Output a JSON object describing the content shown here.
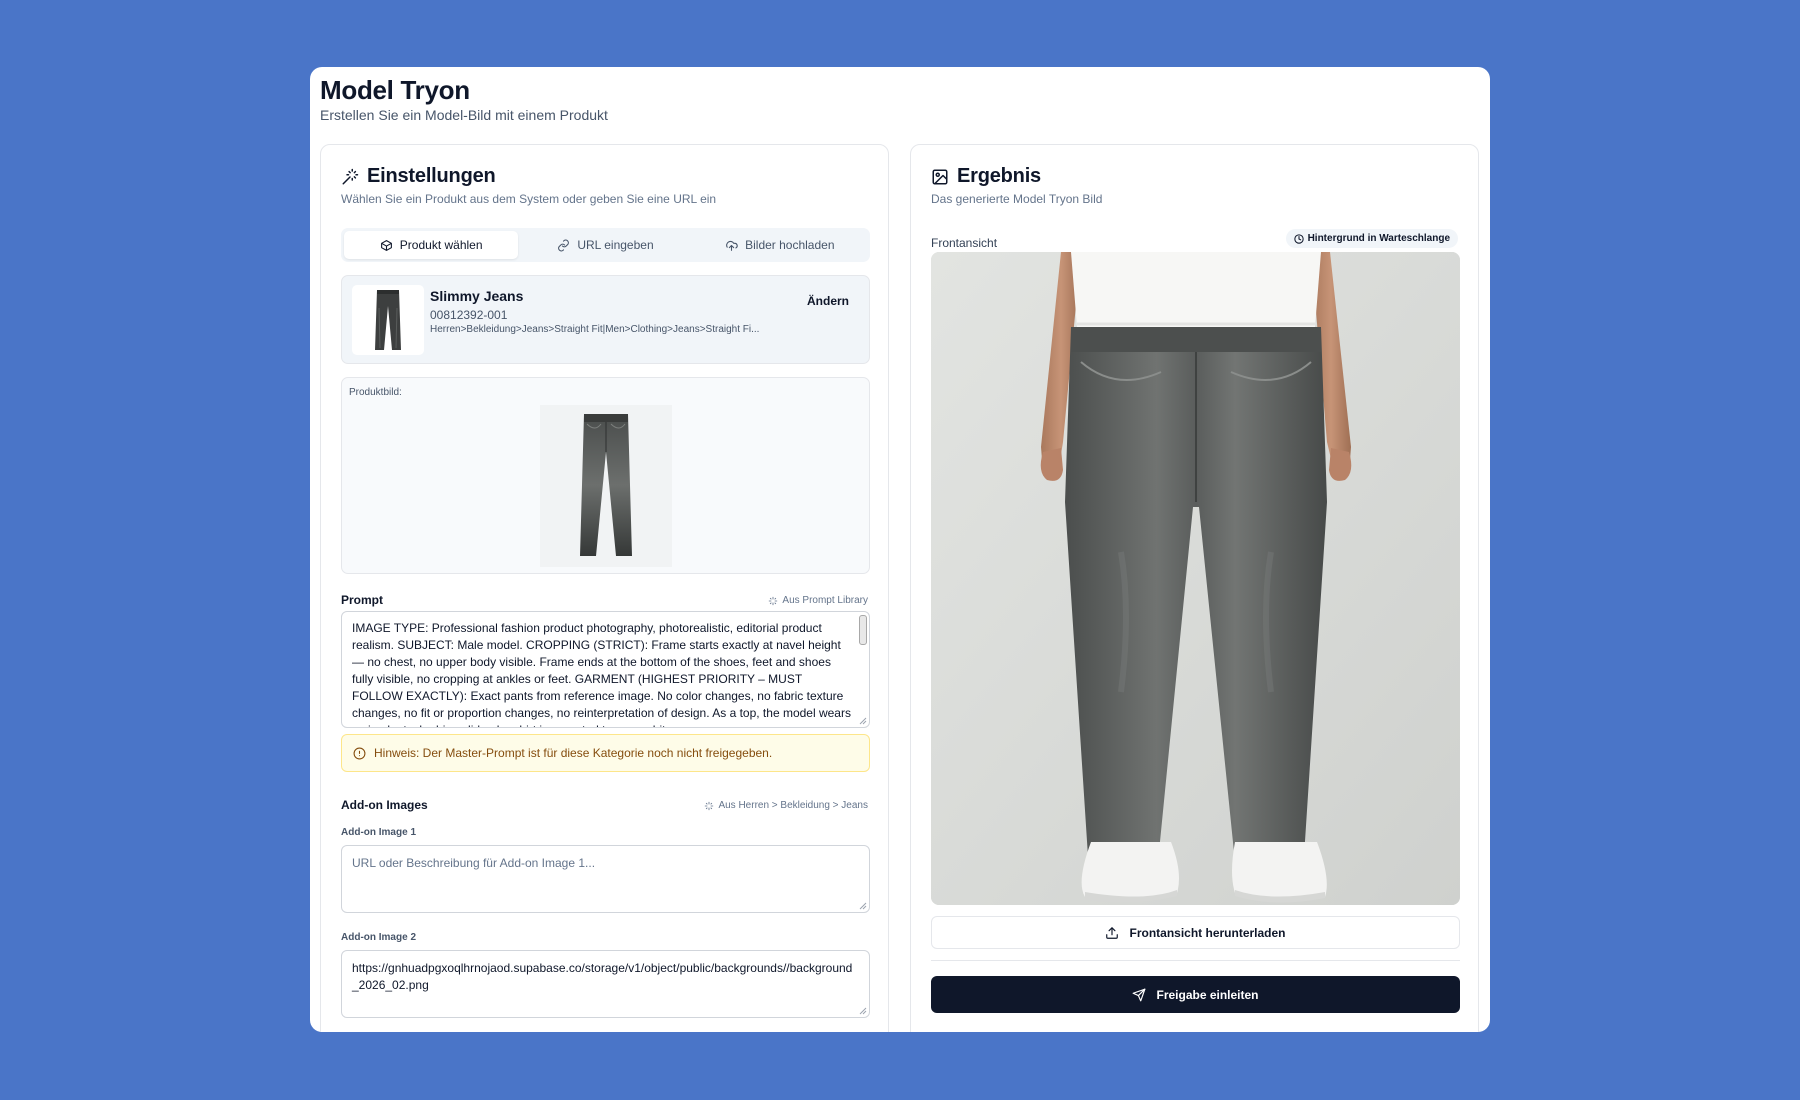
{
  "header": {
    "title": "Model Tryon",
    "subtitle": "Erstellen Sie ein Model-Bild mit einem Produkt"
  },
  "settings": {
    "title": "Einstellungen",
    "subtitle": "Wählen Sie ein Produkt aus dem System oder geben Sie eine URL ein",
    "tabs": [
      {
        "label": "Produkt wählen",
        "icon": "package-icon",
        "active": true
      },
      {
        "label": "URL eingeben",
        "icon": "link-icon",
        "active": false
      },
      {
        "label": "Bilder hochladen",
        "icon": "cloud-upload-icon",
        "active": false
      }
    ],
    "product": {
      "name": "Slimmy Jeans",
      "sku": "00812392-001",
      "path": "Herren>Bekleidung>Jeans>Straight Fit|Men>Clothing>Jeans>Straight Fi...",
      "change_label": "Ändern"
    },
    "product_image_label": "Produktbild:",
    "prompt": {
      "label": "Prompt",
      "source": "Aus Prompt Library",
      "text": "IMAGE TYPE: Professional fashion product photography, photorealistic, editorial product realism. SUBJECT: Male model. CROPPING (STRICT): Frame starts exactly at navel height — no chest, no upper body visible. Frame ends at the bottom of the shoes, feet and shoes fully visible, no cropping at ankles or feet. GARMENT (HIGHEST PRIORITY – MUST FOLLOW EXACTLY): Exact pants from reference image. No color changes, no fabric texture changes, no fit or proportion changes, no reinterpretation of design. As a top, the model wears a simple, tucked-in solid-color shirt in a neutral tone — white, cream, grey"
    },
    "notice": "Hinweis: Der Master-Prompt ist für diese Kategorie noch nicht freigegeben.",
    "addons": {
      "label": "Add-on Images",
      "source": "Aus Herren > Bekleidung > Jeans",
      "image1_label": "Add-on Image 1",
      "image1_placeholder": "URL oder Beschreibung für Add-on Image 1...",
      "image2_label": "Add-on Image 2",
      "image2_value": "https://gnhuadpgxoqlhrnojaod.supabase.co/storage/v1/object/public/backgrounds//background_2026_02.png"
    }
  },
  "result": {
    "title": "Ergebnis",
    "subtitle": "Das generierte Model Tryon Bild",
    "view_label": "Frontansicht",
    "status_badge": "Hintergrund in Warteschlange",
    "download_label": "Frontansicht herunterladen",
    "submit_label": "Freigabe einleiten"
  },
  "colors": {
    "background": "#4a75c8",
    "primary": "#0f172a",
    "notice_bg": "#fefce8",
    "notice_text": "#854d0e"
  }
}
